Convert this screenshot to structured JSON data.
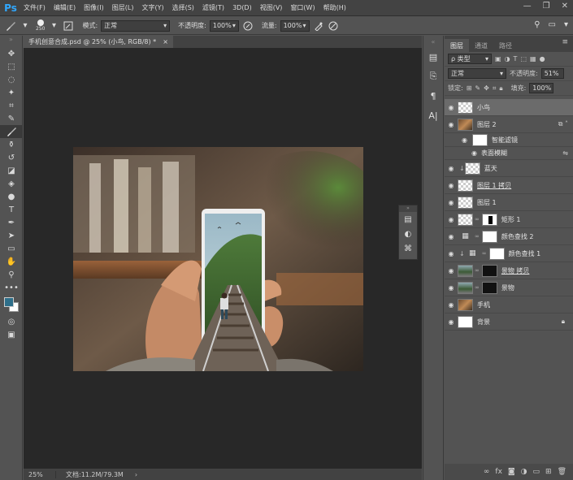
{
  "app": {
    "logo": "Ps"
  },
  "menu": [
    "文件(F)",
    "编辑(E)",
    "图像(I)",
    "图层(L)",
    "文字(Y)",
    "选择(S)",
    "滤镜(T)",
    "3D(D)",
    "视图(V)",
    "窗口(W)",
    "帮助(H)"
  ],
  "window_controls": {
    "minimize": "—",
    "restore": "❐",
    "close": "✕"
  },
  "options": {
    "brush_size": "250",
    "mode_label": "模式:",
    "mode_value": "正常",
    "opacity_label": "不透明度:",
    "opacity_value": "100%",
    "flow_label": "流量:",
    "flow_value": "100%"
  },
  "document": {
    "tab_title": "手机创意合成.psd @ 25% (小鸟, RGB/8) *",
    "close": "×",
    "zoom": "25%",
    "doc_info": "文档:11.2M/79.3M"
  },
  "layers_panel": {
    "tabs": [
      "图层",
      "通道",
      "路径"
    ],
    "filter_kind": "ρ 类型",
    "blend_mode": "正常",
    "opacity_label": "不透明度:",
    "opacity_value": "51%",
    "lock_label": "锁定:",
    "fill_label": "填充:",
    "fill_value": "100%",
    "layers": [
      {
        "name": "小鸟"
      },
      {
        "name": "图层 2"
      },
      {
        "name": "智能滤镜"
      },
      {
        "name": "表面模糊"
      },
      {
        "name": "蓝天"
      },
      {
        "name": "图层 1 拷贝"
      },
      {
        "name": "图层 1"
      },
      {
        "name": "矩形 1"
      },
      {
        "name": "颜色查找 2"
      },
      {
        "name": "颜色查找 1"
      },
      {
        "name": "景物 拷贝"
      },
      {
        "name": "景物"
      },
      {
        "name": "手机"
      },
      {
        "name": "背景"
      }
    ]
  },
  "colors": {
    "foreground": "#2e6f8a",
    "background": "#ffffff",
    "canvas_bg": "#282828",
    "panel_bg": "#535353",
    "selected_layer": "#6b6b6b"
  }
}
